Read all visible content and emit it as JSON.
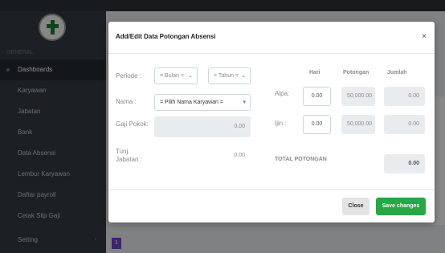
{
  "sidebar": {
    "header": "GENERAL",
    "items": [
      {
        "label": "Dashboards"
      },
      {
        "label": "Karyawan"
      },
      {
        "label": "Jabatan"
      },
      {
        "label": "Bank"
      },
      {
        "label": "Data Absensi"
      },
      {
        "label": "Lembur Karyawan"
      },
      {
        "label": "Daftar payroll"
      },
      {
        "label": "Cetak Slip Gaji"
      },
      {
        "label": "Setting"
      }
    ]
  },
  "pagination": {
    "current": "1"
  },
  "modal": {
    "title": "Add/Edit Data Potongan Absensi",
    "close_icon": "×",
    "periode": {
      "label": "Periode :",
      "bulan_placeholder": "= Bulan =",
      "tahun_placeholder": "= Tahun ="
    },
    "nama": {
      "label": "Nama :",
      "placeholder": "= Pilih Nama Karyawan ="
    },
    "gaji_pokok": {
      "label": "Gaji Pokok:",
      "value": "0.00"
    },
    "tunj_jabatan": {
      "label": "Tunj. Jabatan :",
      "value": "0.00"
    },
    "columns": {
      "hari": "Hari",
      "potongan": "Potongan",
      "jumlah": "Jumlah"
    },
    "alpa": {
      "label": "Alpa:",
      "hari": "0.00",
      "potongan": "50,000.00",
      "jumlah": "0.00"
    },
    "ijin": {
      "label": "Ijin :",
      "hari": "0.00",
      "potongan": "50,000.00",
      "jumlah": "0.00"
    },
    "total": {
      "label": "TOTAL POTONGAN",
      "value": "0.00"
    },
    "buttons": {
      "close": "Close",
      "save": "Save changes"
    }
  },
  "colors": {
    "accent": "#6f42c1",
    "sidebar": "#343a40",
    "save": "#28a745"
  }
}
